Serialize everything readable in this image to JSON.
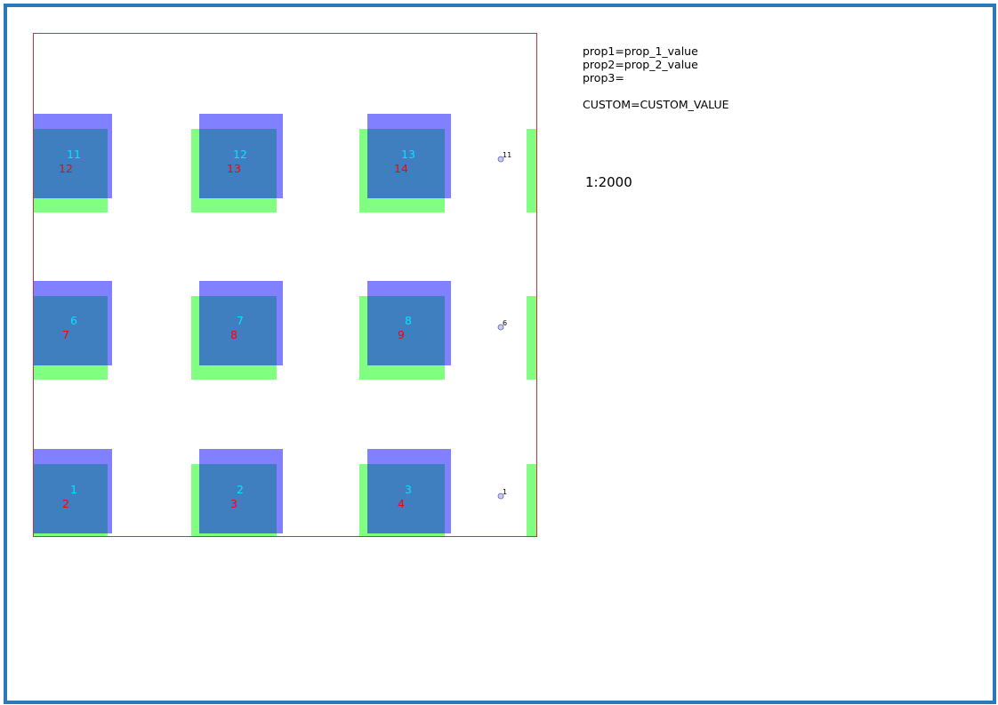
{
  "properties": {
    "prop1": "prop1=prop_1_value",
    "prop2": "prop2=prop_2_value",
    "prop3": "prop3=",
    "custom": "CUSTOM=CUSTOM_VALUE"
  },
  "scale_text": "1:2000",
  "colors": {
    "page_border": "#2a78b8",
    "map_border": "#e8262b",
    "green_fill": "#80ff80",
    "blue_fill": "#6b6bff",
    "cyan_label": "#00e5ff",
    "red_label": "#ff0000"
  },
  "map": {
    "rows": [
      {
        "cells": [
          {
            "blue_label": "11",
            "red_label": "12"
          },
          {
            "blue_label": "12",
            "red_label": "13"
          },
          {
            "blue_label": "13",
            "red_label": "14"
          }
        ],
        "point_label": "11"
      },
      {
        "cells": [
          {
            "blue_label": "6",
            "red_label": "7"
          },
          {
            "blue_label": "7",
            "red_label": "8"
          },
          {
            "blue_label": "8",
            "red_label": "9"
          }
        ],
        "point_label": "6"
      },
      {
        "cells": [
          {
            "blue_label": "1",
            "red_label": "2"
          },
          {
            "blue_label": "2",
            "red_label": "3"
          },
          {
            "blue_label": "3",
            "red_label": "4"
          }
        ],
        "point_label": "1"
      }
    ]
  }
}
